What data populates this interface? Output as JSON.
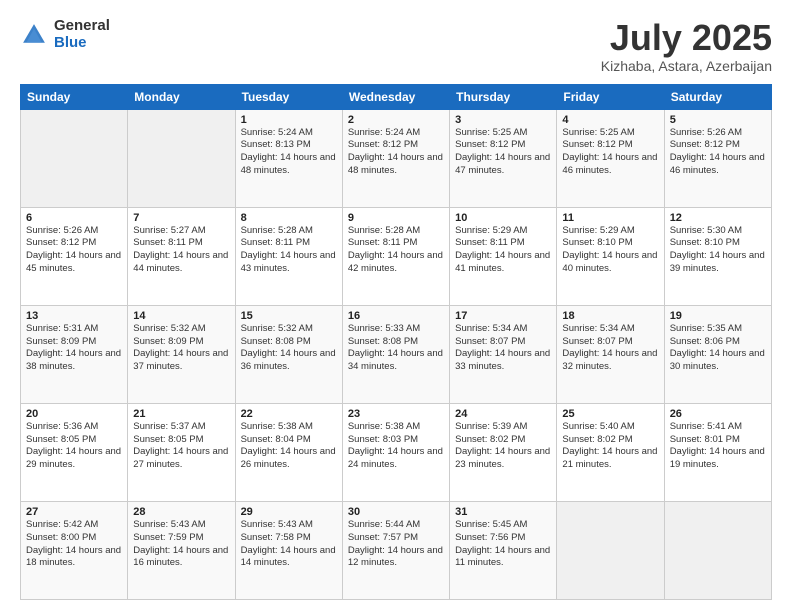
{
  "logo": {
    "general": "General",
    "blue": "Blue"
  },
  "header": {
    "title": "July 2025",
    "subtitle": "Kizhaba, Astara, Azerbaijan"
  },
  "days_of_week": [
    "Sunday",
    "Monday",
    "Tuesday",
    "Wednesday",
    "Thursday",
    "Friday",
    "Saturday"
  ],
  "weeks": [
    [
      {
        "day": "",
        "sunrise": "",
        "sunset": "",
        "daylight": ""
      },
      {
        "day": "",
        "sunrise": "",
        "sunset": "",
        "daylight": ""
      },
      {
        "day": "1",
        "sunrise": "Sunrise: 5:24 AM",
        "sunset": "Sunset: 8:13 PM",
        "daylight": "Daylight: 14 hours and 48 minutes."
      },
      {
        "day": "2",
        "sunrise": "Sunrise: 5:24 AM",
        "sunset": "Sunset: 8:12 PM",
        "daylight": "Daylight: 14 hours and 48 minutes."
      },
      {
        "day": "3",
        "sunrise": "Sunrise: 5:25 AM",
        "sunset": "Sunset: 8:12 PM",
        "daylight": "Daylight: 14 hours and 47 minutes."
      },
      {
        "day": "4",
        "sunrise": "Sunrise: 5:25 AM",
        "sunset": "Sunset: 8:12 PM",
        "daylight": "Daylight: 14 hours and 46 minutes."
      },
      {
        "day": "5",
        "sunrise": "Sunrise: 5:26 AM",
        "sunset": "Sunset: 8:12 PM",
        "daylight": "Daylight: 14 hours and 46 minutes."
      }
    ],
    [
      {
        "day": "6",
        "sunrise": "Sunrise: 5:26 AM",
        "sunset": "Sunset: 8:12 PM",
        "daylight": "Daylight: 14 hours and 45 minutes."
      },
      {
        "day": "7",
        "sunrise": "Sunrise: 5:27 AM",
        "sunset": "Sunset: 8:11 PM",
        "daylight": "Daylight: 14 hours and 44 minutes."
      },
      {
        "day": "8",
        "sunrise": "Sunrise: 5:28 AM",
        "sunset": "Sunset: 8:11 PM",
        "daylight": "Daylight: 14 hours and 43 minutes."
      },
      {
        "day": "9",
        "sunrise": "Sunrise: 5:28 AM",
        "sunset": "Sunset: 8:11 PM",
        "daylight": "Daylight: 14 hours and 42 minutes."
      },
      {
        "day": "10",
        "sunrise": "Sunrise: 5:29 AM",
        "sunset": "Sunset: 8:11 PM",
        "daylight": "Daylight: 14 hours and 41 minutes."
      },
      {
        "day": "11",
        "sunrise": "Sunrise: 5:29 AM",
        "sunset": "Sunset: 8:10 PM",
        "daylight": "Daylight: 14 hours and 40 minutes."
      },
      {
        "day": "12",
        "sunrise": "Sunrise: 5:30 AM",
        "sunset": "Sunset: 8:10 PM",
        "daylight": "Daylight: 14 hours and 39 minutes."
      }
    ],
    [
      {
        "day": "13",
        "sunrise": "Sunrise: 5:31 AM",
        "sunset": "Sunset: 8:09 PM",
        "daylight": "Daylight: 14 hours and 38 minutes."
      },
      {
        "day": "14",
        "sunrise": "Sunrise: 5:32 AM",
        "sunset": "Sunset: 8:09 PM",
        "daylight": "Daylight: 14 hours and 37 minutes."
      },
      {
        "day": "15",
        "sunrise": "Sunrise: 5:32 AM",
        "sunset": "Sunset: 8:08 PM",
        "daylight": "Daylight: 14 hours and 36 minutes."
      },
      {
        "day": "16",
        "sunrise": "Sunrise: 5:33 AM",
        "sunset": "Sunset: 8:08 PM",
        "daylight": "Daylight: 14 hours and 34 minutes."
      },
      {
        "day": "17",
        "sunrise": "Sunrise: 5:34 AM",
        "sunset": "Sunset: 8:07 PM",
        "daylight": "Daylight: 14 hours and 33 minutes."
      },
      {
        "day": "18",
        "sunrise": "Sunrise: 5:34 AM",
        "sunset": "Sunset: 8:07 PM",
        "daylight": "Daylight: 14 hours and 32 minutes."
      },
      {
        "day": "19",
        "sunrise": "Sunrise: 5:35 AM",
        "sunset": "Sunset: 8:06 PM",
        "daylight": "Daylight: 14 hours and 30 minutes."
      }
    ],
    [
      {
        "day": "20",
        "sunrise": "Sunrise: 5:36 AM",
        "sunset": "Sunset: 8:05 PM",
        "daylight": "Daylight: 14 hours and 29 minutes."
      },
      {
        "day": "21",
        "sunrise": "Sunrise: 5:37 AM",
        "sunset": "Sunset: 8:05 PM",
        "daylight": "Daylight: 14 hours and 27 minutes."
      },
      {
        "day": "22",
        "sunrise": "Sunrise: 5:38 AM",
        "sunset": "Sunset: 8:04 PM",
        "daylight": "Daylight: 14 hours and 26 minutes."
      },
      {
        "day": "23",
        "sunrise": "Sunrise: 5:38 AM",
        "sunset": "Sunset: 8:03 PM",
        "daylight": "Daylight: 14 hours and 24 minutes."
      },
      {
        "day": "24",
        "sunrise": "Sunrise: 5:39 AM",
        "sunset": "Sunset: 8:02 PM",
        "daylight": "Daylight: 14 hours and 23 minutes."
      },
      {
        "day": "25",
        "sunrise": "Sunrise: 5:40 AM",
        "sunset": "Sunset: 8:02 PM",
        "daylight": "Daylight: 14 hours and 21 minutes."
      },
      {
        "day": "26",
        "sunrise": "Sunrise: 5:41 AM",
        "sunset": "Sunset: 8:01 PM",
        "daylight": "Daylight: 14 hours and 19 minutes."
      }
    ],
    [
      {
        "day": "27",
        "sunrise": "Sunrise: 5:42 AM",
        "sunset": "Sunset: 8:00 PM",
        "daylight": "Daylight: 14 hours and 18 minutes."
      },
      {
        "day": "28",
        "sunrise": "Sunrise: 5:43 AM",
        "sunset": "Sunset: 7:59 PM",
        "daylight": "Daylight: 14 hours and 16 minutes."
      },
      {
        "day": "29",
        "sunrise": "Sunrise: 5:43 AM",
        "sunset": "Sunset: 7:58 PM",
        "daylight": "Daylight: 14 hours and 14 minutes."
      },
      {
        "day": "30",
        "sunrise": "Sunrise: 5:44 AM",
        "sunset": "Sunset: 7:57 PM",
        "daylight": "Daylight: 14 hours and 12 minutes."
      },
      {
        "day": "31",
        "sunrise": "Sunrise: 5:45 AM",
        "sunset": "Sunset: 7:56 PM",
        "daylight": "Daylight: 14 hours and 11 minutes."
      },
      {
        "day": "",
        "sunrise": "",
        "sunset": "",
        "daylight": ""
      },
      {
        "day": "",
        "sunrise": "",
        "sunset": "",
        "daylight": ""
      }
    ]
  ]
}
